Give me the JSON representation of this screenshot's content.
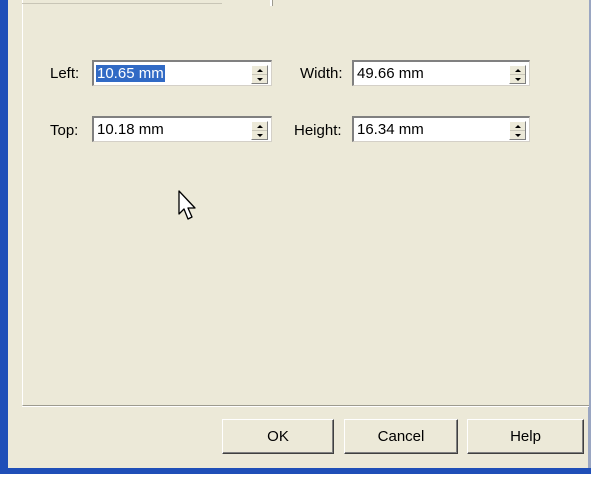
{
  "fields": {
    "left": {
      "label": "Left:",
      "value": "10.65 mm"
    },
    "top": {
      "label": "Top:",
      "value": "10.18 mm"
    },
    "width": {
      "label": "Width:",
      "value": "49.66 mm"
    },
    "height": {
      "label": "Height:",
      "value": "16.34 mm"
    }
  },
  "buttons": {
    "ok": "OK",
    "cancel": "Cancel",
    "help": "Help"
  },
  "colors": {
    "dialog_bg": "#ece9d8",
    "selection": "#316ac5",
    "window_frame": "#1f4fb8"
  },
  "icons": [
    "spin-up-icon",
    "spin-down-icon",
    "mouse-pointer-icon"
  ]
}
